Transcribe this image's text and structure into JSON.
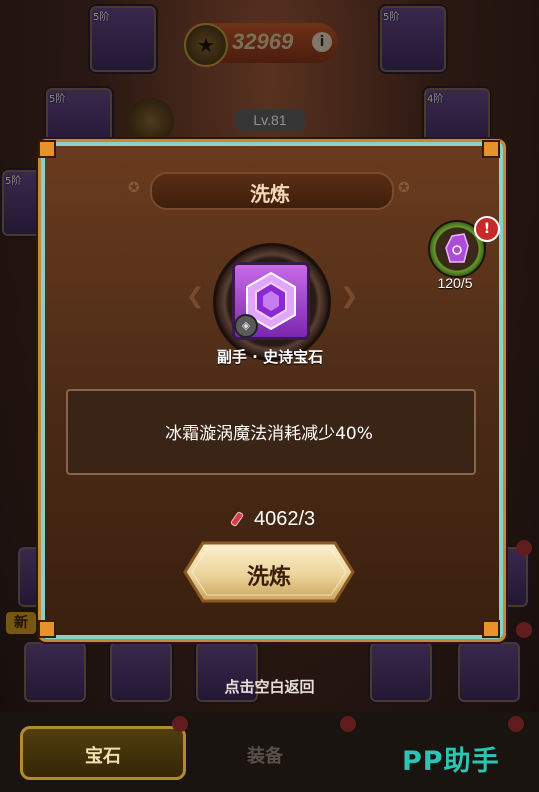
{
  "background": {
    "gold_value": "32969",
    "level": "Lv.81",
    "slot_tiers": [
      "5阶",
      "5阶",
      "5阶",
      "4阶",
      "5阶"
    ],
    "info_icon": "info-icon"
  },
  "modal": {
    "title": "洗炼",
    "gem_name": "副手 · 史诗宝石",
    "effect": "冰霜漩涡魔法消耗减少40%",
    "cost": "4062/3",
    "refine_button": "洗炼",
    "stone_count": "120/5",
    "stone_alert": "!"
  },
  "hint": "点击空白返回",
  "new_tag": "新",
  "tabs": {
    "gem": "宝石",
    "equipment": "装备"
  },
  "watermark": "PP助手",
  "colors": {
    "accent_gold": "#e8c37a",
    "modal_border": "#c48a3c",
    "gem_purple": "#9b3fd6",
    "alert_red": "#c82a2a",
    "watermark_teal": "#2ec4b4"
  }
}
